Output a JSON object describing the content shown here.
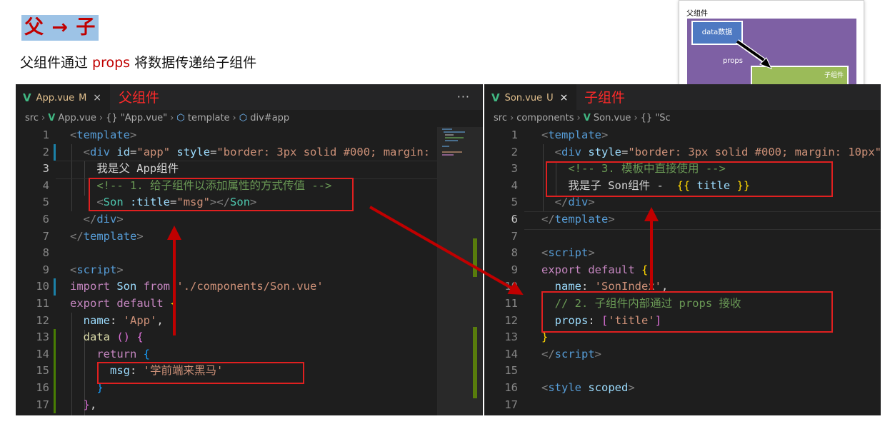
{
  "page": {
    "title": "父 → 子",
    "subtitle_before": "父组件通过 ",
    "subtitle_keyword": "props",
    "subtitle_after": " 将数据传递给子组件"
  },
  "diagram": {
    "parent_label": "父组件",
    "data_label": "data数据",
    "props_label": "props",
    "child_label": "子组件",
    "dash_line": "--------------------"
  },
  "left_editor": {
    "tab_name": "App.vue",
    "tab_badge": "M",
    "tab_close": "×",
    "red_label": "父组件",
    "more": "···",
    "breadcrumb": {
      "p1": "src",
      "p2": "App.vue",
      "p3": "{} \"App.vue\"",
      "p4": "template",
      "p5": "div#app"
    },
    "line_numbers": [
      "1",
      "2",
      "3",
      "4",
      "5",
      "6",
      "7",
      "8",
      "9",
      "10",
      "11",
      "12",
      "13",
      "14",
      "15",
      "16",
      "17"
    ],
    "code": {
      "l1": "<template>",
      "l2_tag": "div",
      "l2_a1": "id",
      "l2_v1": "\"app\"",
      "l2_a2": "style",
      "l2_v2": "\"border: 3px solid #000; margin:",
      "l3": "我是父 App组件",
      "l4": "<!-- 1. 给子组件以添加属性的方式传值 -->",
      "l5_tag": "Son",
      "l5_attr": ":title",
      "l5_val": "\"msg\"",
      "l5_close": "Son",
      "l6": "div",
      "l7": "template",
      "l9": "script",
      "l10_kw": "import",
      "l10_name": "Son",
      "l10_from": "from",
      "l10_path": "'./components/Son.vue'",
      "l11_kw1": "export",
      "l11_kw2": "default",
      "l12_key": "name",
      "l12_val": "'App'",
      "l13_fn": "data",
      "l14_kw": "return",
      "l15_key": "msg",
      "l15_val": "'学前端来黑马'"
    }
  },
  "right_editor": {
    "tab_name": "Son.vue",
    "tab_badge": "U",
    "tab_close": "×",
    "red_label": "子组件",
    "breadcrumb": {
      "p1": "src",
      "p2": "components",
      "p3": "Son.vue",
      "p4": "{} \"Sc"
    },
    "line_numbers": [
      "1",
      "2",
      "3",
      "4",
      "5",
      "6",
      "7",
      "8",
      "9",
      "10",
      "11",
      "12",
      "13",
      "14",
      "15",
      "16",
      "17"
    ],
    "code": {
      "l1": "template",
      "l2_tag": "div",
      "l2_attr": "style",
      "l2_val": "\"border: 3px solid #000; margin: 10px\"",
      "l3": "<!-- 3. 模板中直接使用 -->",
      "l4_text": "我是子 Son组件 -  ",
      "l4_open": "{{",
      "l4_var": " title ",
      "l4_close": "}}",
      "l5": "div",
      "l6": "template",
      "l8": "script",
      "l9_kw1": "export",
      "l9_kw2": "default",
      "l10_key": "name",
      "l10_val": "'SonIndex'",
      "l11": "// 2. 子组件内部通过 props 接收",
      "l12_key": "props",
      "l12_val": "'title'",
      "l14": "script",
      "l16_tag": "style",
      "l16_attr": "scoped"
    }
  },
  "colors": {
    "accent_red": "#e02020",
    "title_bg": "#9dc3e6",
    "editor_bg": "#1e1e1e"
  }
}
